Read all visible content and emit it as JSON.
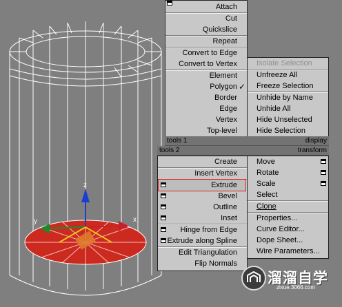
{
  "quad_top": {
    "items": [
      {
        "label": "Attach",
        "has_box": true
      },
      {
        "label": "Cut"
      },
      {
        "label": "Quickslice"
      },
      {
        "label": "Repeat"
      },
      {
        "label": "Convert to Edge"
      },
      {
        "label": "Convert to Vertex"
      },
      {
        "label": "Element"
      },
      {
        "label": "Polygon",
        "checked": true
      },
      {
        "label": "Border"
      },
      {
        "label": "Edge"
      },
      {
        "label": "Vertex"
      },
      {
        "label": "Top-level"
      }
    ],
    "left_header": "tools 1",
    "right_header": "display",
    "display_items": [
      {
        "label": "Isolate Selection",
        "disabled": true
      },
      {
        "label": "Unfreeze All"
      },
      {
        "label": "Freeze Selection"
      },
      {
        "label": "Unhide by Name"
      },
      {
        "label": "Unhide All"
      },
      {
        "label": "Hide Unselected"
      },
      {
        "label": "Hide Selection"
      }
    ]
  },
  "quad_bottom": {
    "left_header": "tools 2",
    "right_header": "transform",
    "tools2_items": [
      {
        "label": "Create"
      },
      {
        "label": "Insert Vertex"
      },
      {
        "label": "Extrude",
        "has_box": true,
        "highlighted": true
      },
      {
        "label": "Bevel",
        "has_box": true
      },
      {
        "label": "Outline",
        "has_box": true
      },
      {
        "label": "Inset",
        "has_box": true
      },
      {
        "label": "Hinge from Edge",
        "has_box": true
      },
      {
        "label": "Extrude along Spline",
        "has_box": true
      },
      {
        "label": "Edit Triangulation"
      },
      {
        "label": "Flip Normals"
      }
    ],
    "transform_items": [
      {
        "label": "Move",
        "has_box": true
      },
      {
        "label": "Rotate",
        "has_box": true
      },
      {
        "label": "Scale",
        "has_box": true
      },
      {
        "label": "Select"
      },
      {
        "label": "Clone"
      },
      {
        "label": "Properties..."
      },
      {
        "label": "Curve Editor..."
      },
      {
        "label": "Dope Sheet..."
      },
      {
        "label": "Wire Parameters..."
      }
    ]
  },
  "gizmo": {
    "x_label": "x",
    "y_label": "y",
    "z_label": "z"
  },
  "watermark": {
    "name": "溜溜自学",
    "url": "zixue.3066.com"
  },
  "colors": {
    "viewport": "#7f7f7f",
    "menu": "#c8c8c8",
    "header": "#737373",
    "selection": "#cc2a1f",
    "highlight_border": "#d22222"
  }
}
